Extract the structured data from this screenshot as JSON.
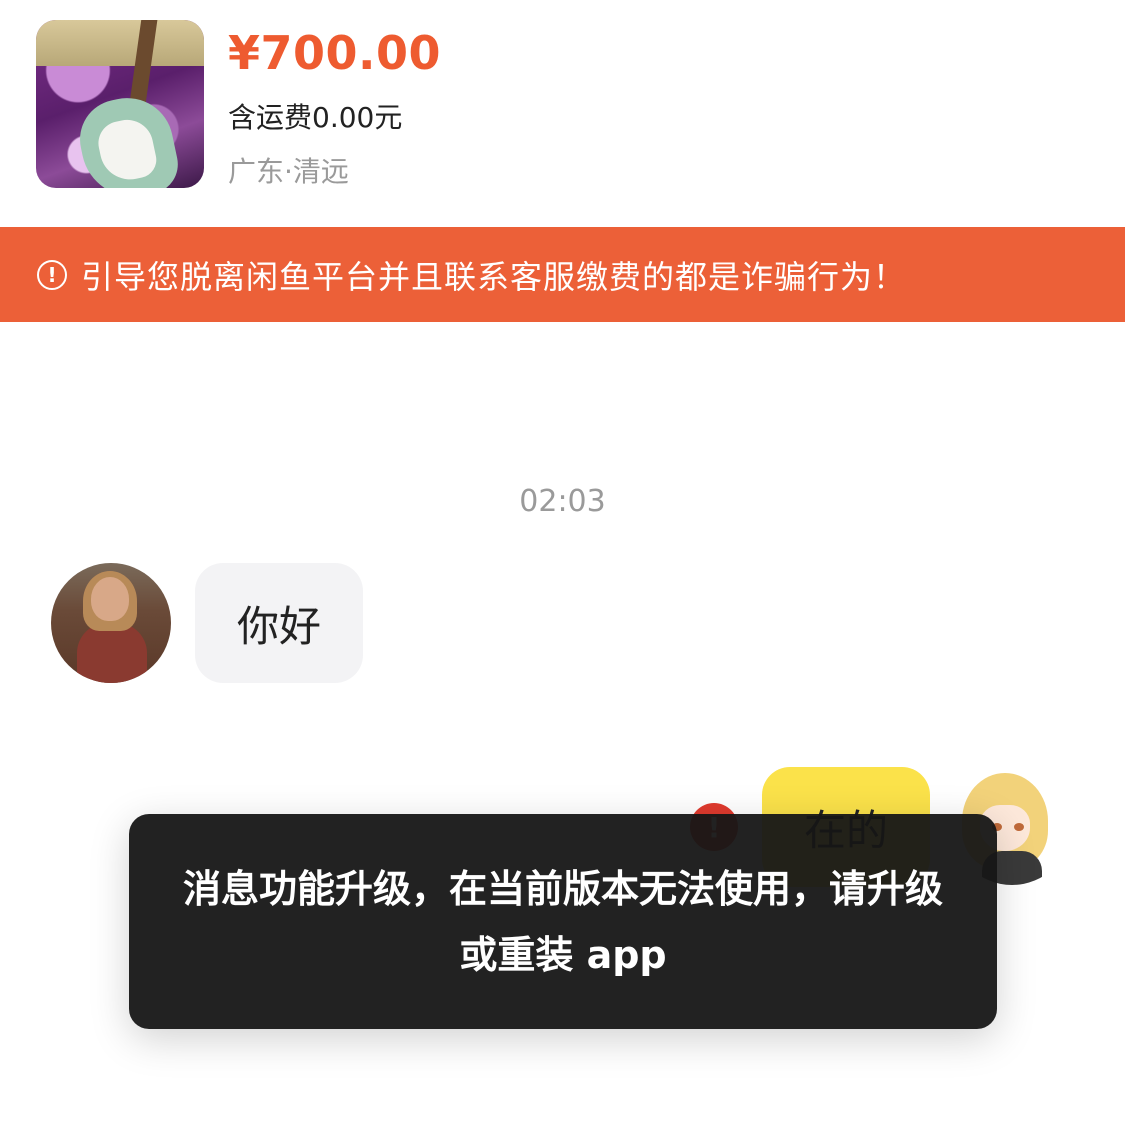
{
  "product": {
    "price": "¥700.00",
    "shipping": "含运费0.00元",
    "location": "广东·清远",
    "thumbnail_icon": "guitar-photo"
  },
  "warning": {
    "icon": "alert-circle-icon",
    "text": "引导您脱离闲鱼平台并且联系客服缴费的都是诈骗行为！"
  },
  "chat": {
    "timestamp": "02:03",
    "messages": [
      {
        "side": "left",
        "text": "你好"
      },
      {
        "side": "right",
        "text": "在的",
        "status": "failed",
        "status_icon": "!"
      }
    ]
  },
  "toast": {
    "text": "消息功能升级，在当前版本无法使用，请升级或重装 app"
  },
  "colors": {
    "accent": "#ee5b30",
    "banner": "#ec6038",
    "self_bubble": "#fbe24a",
    "other_bubble": "#f3f3f5",
    "error": "#e03a2e",
    "toast_bg": "#161616"
  }
}
